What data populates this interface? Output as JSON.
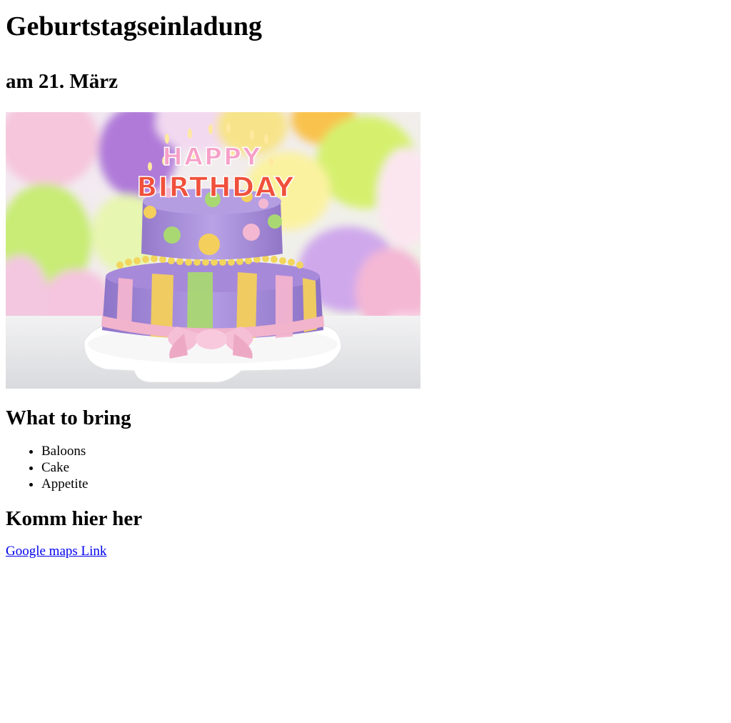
{
  "page": {
    "title": "Geburtstagseinladung",
    "date_line": "am 21. März"
  },
  "image": {
    "candle_letters_top": "HAPPY",
    "candle_letters_bottom": "BIRTHDAY"
  },
  "bring": {
    "heading": "What to bring",
    "items": [
      "Baloons",
      "Cake",
      "Appetite"
    ]
  },
  "location": {
    "heading": "Komm hier her",
    "link_label": "Google maps Link"
  },
  "colors": {
    "link": "#0000ee",
    "cake_top": "#a889d6",
    "cake_bottom": "#9b7fd4",
    "ribbon": "#f3b8d0"
  }
}
